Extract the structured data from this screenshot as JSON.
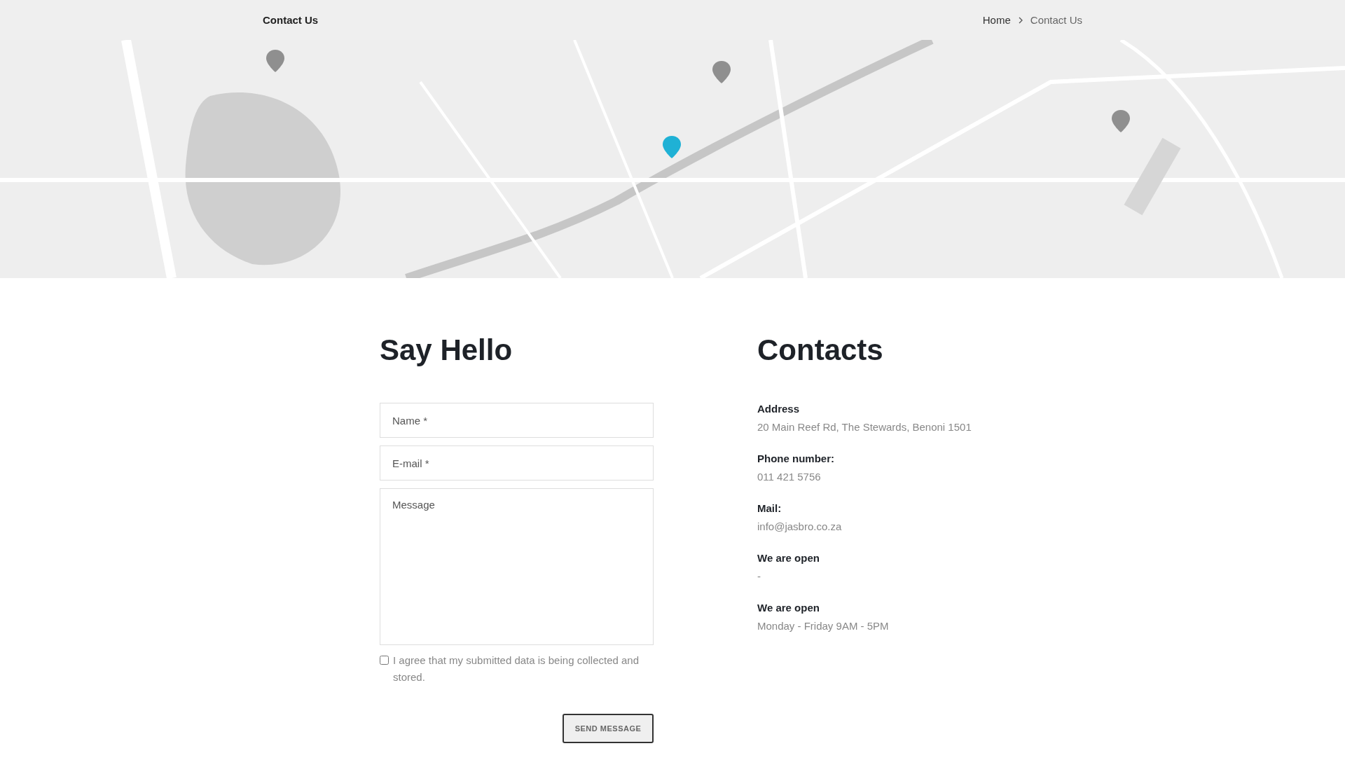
{
  "header": {
    "title": "Contact Us",
    "breadcrumb": [
      {
        "label": "Home",
        "current": false
      },
      {
        "label": "Contact Us",
        "current": true
      }
    ]
  },
  "form": {
    "title": "Say Hello",
    "fields": [
      {
        "kind": "input",
        "placeholder": "Name *"
      },
      {
        "kind": "input",
        "placeholder": "E-mail *"
      },
      {
        "kind": "textarea",
        "placeholder": "Message"
      }
    ],
    "consent": {
      "label": "I agree that my submitted data is being collected and stored.",
      "checked": false
    },
    "submit": "SEND MESSAGE"
  },
  "contacts": {
    "title": "Contacts",
    "items": [
      {
        "label": "Address",
        "value": "20 Main Reef Rd, The Stewards, Benoni 1501"
      },
      {
        "label": "Phone number:",
        "value": "011 421 5756"
      },
      {
        "label": "Mail:",
        "value": "info@jasbro.co.za"
      },
      {
        "label": "We are open",
        "value": "-"
      },
      {
        "label": "We are open",
        "value": "Monday - Friday 9AM - 5PM"
      }
    ]
  }
}
